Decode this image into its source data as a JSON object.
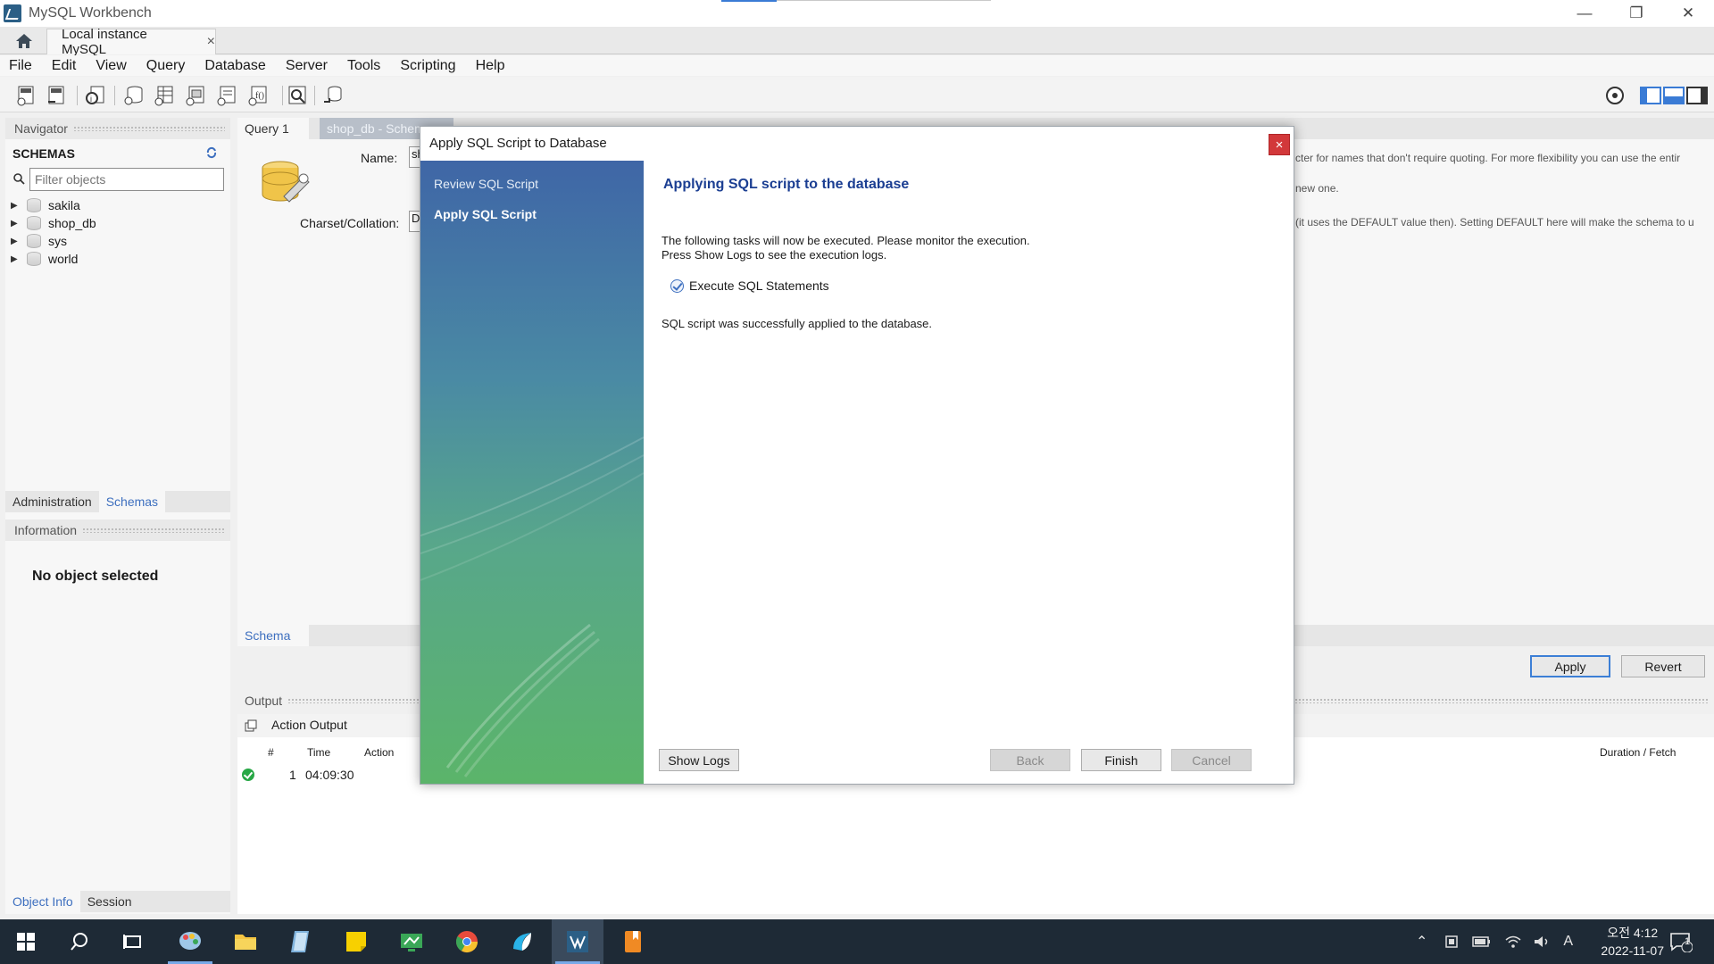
{
  "window": {
    "title": "MySQL Workbench",
    "tab_label": "Local instance MySQL",
    "tab_close": "×",
    "controls": {
      "minimize": "—",
      "restore": "❐",
      "close": "✕"
    }
  },
  "menu": [
    "File",
    "Edit",
    "View",
    "Query",
    "Database",
    "Server",
    "Tools",
    "Scripting",
    "Help"
  ],
  "navigator": {
    "header": "Navigator",
    "schemas_label": "SCHEMAS",
    "filter_placeholder": "Filter objects",
    "schemas": [
      "sakila",
      "shop_db",
      "sys",
      "world"
    ],
    "tabs": {
      "administration": "Administration",
      "schemas": "Schemas"
    },
    "information_header": "Information",
    "no_object": "No object selected",
    "bottom_tabs": {
      "object_info": "Object Info",
      "session": "Session"
    }
  },
  "editor": {
    "tabs": {
      "query": "Query 1",
      "schema": "shop_db - Schema"
    },
    "name_label": "Name:",
    "name_value": "sh",
    "charset_label": "Charset/Collation:",
    "charset_value": "D",
    "help_text_1": "cter for names that don't require quoting. For more flexibility you can use the entir",
    "help_text_2": "new one.",
    "help_text_3": "(it uses the DEFAULT value then). Setting DEFAULT here will make the schema to u",
    "schema_tab": "Schema",
    "apply_label": "Apply",
    "revert_label": "Revert"
  },
  "output": {
    "header": "Output",
    "type_label": "Action Output",
    "columns": {
      "num": "#",
      "time": "Time",
      "action": "Action",
      "duration": "Duration / Fetch"
    },
    "rows": [
      {
        "num": "1",
        "time": "04:09:30"
      }
    ]
  },
  "dialog": {
    "title": "Apply SQL Script to Database",
    "close": "×",
    "steps": [
      "Review SQL Script",
      "Apply SQL Script"
    ],
    "heading": "Applying SQL script to the database",
    "desc_line1": "The following tasks will now be executed. Please monitor the execution.",
    "desc_line2": "Press Show Logs to see the execution logs.",
    "task": "Execute SQL Statements",
    "success": "SQL script was successfully applied to the database.",
    "buttons": {
      "show_logs": "Show Logs",
      "back": "Back",
      "finish": "Finish",
      "cancel": "Cancel"
    }
  },
  "taskbar": {
    "ime": "A",
    "clock_time": "오전 4:12",
    "clock_date": "2022-11-07",
    "notifications": "1"
  },
  "colors": {
    "accent": "#3d6fbf",
    "heading": "#1b3e92",
    "dialog_close": "#d2383a",
    "taskbar": "#1e2a36"
  }
}
